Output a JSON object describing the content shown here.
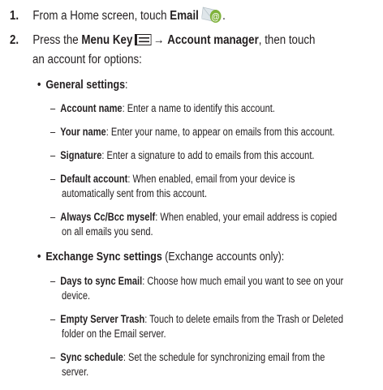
{
  "steps": [
    {
      "num": "1.",
      "pre": "From a Home screen, touch ",
      "bold": "Email",
      "post": ".",
      "icon": "email-app-icon"
    },
    {
      "num": "2.",
      "pre": "Press the ",
      "bold1": "Menu Key",
      "arrow": "→",
      "bold2": "Account manager",
      "post": ", then touch",
      "cont": "an account for options:",
      "icon": "menu-key-icon"
    }
  ],
  "sections": [
    {
      "bullet": "•",
      "title": "General settings",
      "title_suffix": ":",
      "items": [
        {
          "term": "Account name",
          "desc": ": Enter a name to identify this account."
        },
        {
          "term": "Your name",
          "desc": ": Enter your name, to appear on emails from this account."
        },
        {
          "term": "Signature",
          "desc": ": Enter a signature to add to emails from this account."
        },
        {
          "term": "Default account",
          "desc": ": When enabled, email from your device is",
          "cont": "automatically sent from this account."
        },
        {
          "term": "Always Cc/Bcc myself",
          "desc": ": When enabled, your email address is copied",
          "cont": "on all emails you send."
        }
      ]
    },
    {
      "bullet": "•",
      "title": "Exchange Sync settings",
      "title_suffix": " (Exchange accounts only):",
      "items": [
        {
          "term": "Days to sync Email",
          "desc": ": Choose how much email you want to see on your",
          "cont": "device."
        },
        {
          "term": "Empty Server Trash",
          "desc": ": Touch to delete emails from the Trash or Deleted",
          "cont": "folder on the Email server."
        },
        {
          "term": "Sync schedule",
          "desc": ": Set the schedule for synchronizing email from the",
          "cont": "server."
        }
      ]
    }
  ],
  "dash": "–",
  "colors": {
    "text": "#231f20",
    "icon_green": "#7fb23a",
    "icon_envelope": "#dfe6ea"
  }
}
